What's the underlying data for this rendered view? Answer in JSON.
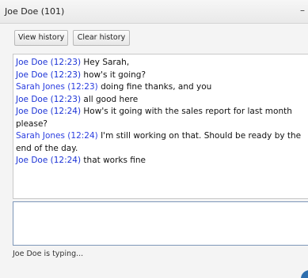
{
  "window": {
    "title": "Joe Doe (101)",
    "minimize_glyph": "–"
  },
  "toolbar": {
    "view_history_label": "View history",
    "clear_history_label": "Clear history"
  },
  "messages": [
    {
      "sender": "Joe Doe (12:23)",
      "text": " Hey Sarah,"
    },
    {
      "sender": "Joe Doe (12:23)",
      "text": " how's it going?"
    },
    {
      "sender": "Sarah Jones (12:23)",
      "text": " doing fine thanks, and you"
    },
    {
      "sender": "Joe Doe (12:23)",
      "text": " all good here"
    },
    {
      "sender": "Joe Doe (12:24)",
      "text": " How's it going with the sales report for last month please?"
    },
    {
      "sender": "Sarah Jones (12:24)",
      "text": " I'm still working on that. Should be ready by the end of the day."
    },
    {
      "sender": "Joe Doe (12:24)",
      "text": " that works fine"
    }
  ],
  "input": {
    "value": ""
  },
  "status": {
    "typing_text": "Joe Doe  is typing..."
  },
  "colors": {
    "sender_joe": "#1b33d6",
    "sender_sarah": "#2b3ee0",
    "bubble": "#2f6fae"
  },
  "icons": {
    "chat_bubble": "chat-bubble-icon"
  }
}
